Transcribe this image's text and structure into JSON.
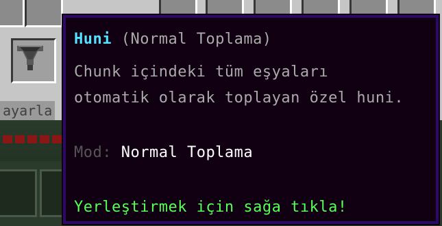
{
  "inventory": {
    "label_fragment": "ayarla",
    "hover_item_icon": "hopper-icon"
  },
  "tooltip": {
    "title_name": "Huni",
    "title_sub": "(Normal Toplama)",
    "description_line1": "Chunk içindeki tüm eşyaları",
    "description_line2": "otomatik olarak toplayan özel huni.",
    "mod_label": "Mod:",
    "mod_value": "Normal Toplama",
    "action_hint": "Yerleştirmek için sağa tıkla!",
    "colors": {
      "background": "#110012",
      "border": "#2b0a63",
      "title": "#55e1ff",
      "text": "#aaaaaa",
      "mod_label": "#555555",
      "mod_value": "#ffffff",
      "action": "#55ff55"
    }
  }
}
